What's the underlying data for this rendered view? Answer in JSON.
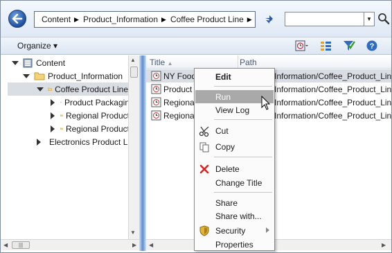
{
  "breadcrumb": {
    "items": [
      "Content",
      "Product_Information",
      "Coffee Product Line"
    ]
  },
  "search": {
    "value": "",
    "placeholder": ""
  },
  "toolbar": {
    "organize_label": "Organize ▾"
  },
  "tree": {
    "items": [
      {
        "label": "Content",
        "expanded": true
      },
      {
        "label": "Product_Information",
        "expanded": true
      },
      {
        "label": "Coffee Product Line",
        "expanded": true,
        "selected": true
      },
      {
        "label": "Product Packagin",
        "expanded": false
      },
      {
        "label": "Regional Product",
        "expanded": false
      },
      {
        "label": "Regional Product",
        "expanded": false
      },
      {
        "label": "Electronics Product Li",
        "expanded": false
      }
    ]
  },
  "list": {
    "columns": {
      "title": "Title",
      "path": "Path"
    },
    "rows": [
      {
        "title": "NY Food",
        "path": "Information/Coffee_Product_Line"
      },
      {
        "title": "Product F",
        "path": "Information/Coffee_Product_Line"
      },
      {
        "title": "Regional",
        "path": "Information/Coffee_Product_Line"
      },
      {
        "title": "Regional",
        "path": "Information/Coffee_Product_Line"
      }
    ]
  },
  "context_menu": {
    "edit": "Edit",
    "run": "Run",
    "view_log": "View Log",
    "cut": "Cut",
    "copy": "Copy",
    "delete": "Delete",
    "change_title": "Change Title",
    "share": "Share",
    "share_with": "Share with...",
    "security": "Security",
    "properties": "Properties"
  },
  "colors": {
    "accent": "#5d8cd0",
    "selection": "#d9dde4",
    "menu_hover": "#a9a9a9"
  },
  "icons": [
    "back-icon",
    "refresh-icon",
    "search-icon",
    "scheduler-icon",
    "columns-icon",
    "filter-icon",
    "help-icon",
    "folder-icon",
    "report-icon",
    "cut-icon",
    "copy-icon",
    "delete-icon",
    "shield-icon"
  ]
}
